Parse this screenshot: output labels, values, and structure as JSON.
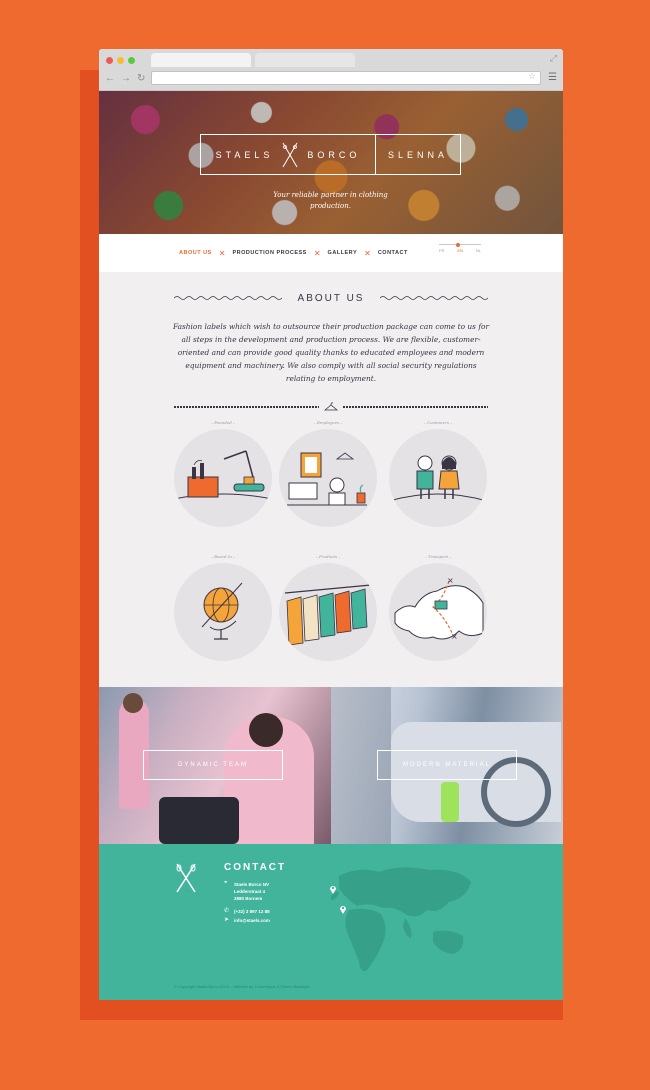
{
  "browser": {
    "url": "",
    "traffic_lights": [
      "#ec5b55",
      "#f3bd35",
      "#5dc83f"
    ]
  },
  "hero": {
    "logo_part1": "STAELS",
    "logo_part2": "BORCO",
    "logo_part3": "SLENNA",
    "tagline": "Your reliable partner in clothing production."
  },
  "nav": {
    "items": [
      {
        "label": "ABOUT US",
        "active": true
      },
      {
        "label": "PRODUCTION PROCESS",
        "active": false
      },
      {
        "label": "GALLERY",
        "active": false
      },
      {
        "label": "CONTACT",
        "active": false
      }
    ],
    "languages": [
      "FR",
      "EN",
      "NL"
    ],
    "active_language": "EN"
  },
  "about": {
    "title": "ABOUT US",
    "text": "Fashion labels which wish to outsource their production package can come to us for all steps in the development and production process. We are flexible, customer-oriented and can provide good quality thanks to educated employees and modern equipment and machinery. We also comply with all social security regulations relating to employment."
  },
  "features": [
    {
      "caption": "– Founded –",
      "icon": "factory-icon"
    },
    {
      "caption": "– Employees –",
      "icon": "office-icon"
    },
    {
      "caption": "– Customers –",
      "icon": "customers-icon"
    },
    {
      "caption": "– Based In –",
      "icon": "globe-icon"
    },
    {
      "caption": "– Products –",
      "icon": "clothes-rack-icon"
    },
    {
      "caption": "– Transport –",
      "icon": "map-route-icon"
    }
  ],
  "photos": {
    "left_button": "DYNAMIC TEAM",
    "right_button": "MODERN MATERIAL"
  },
  "contact": {
    "title": "CONTACT",
    "company": "Staels Borco NV",
    "street": "Ledderstraat 4",
    "city": "2880 Bornem",
    "phone": "(+32) 3 897 12 88",
    "email": "info@staels.com",
    "footer": "© Copyright Staels Borco 2013 – Website by Turtomaque & Flemm Boutique"
  },
  "colors": {
    "accent": "#ee6a2f",
    "contact_bg": "#41b49b",
    "page_bg": "#f1eff0",
    "text": "#3a3445"
  }
}
